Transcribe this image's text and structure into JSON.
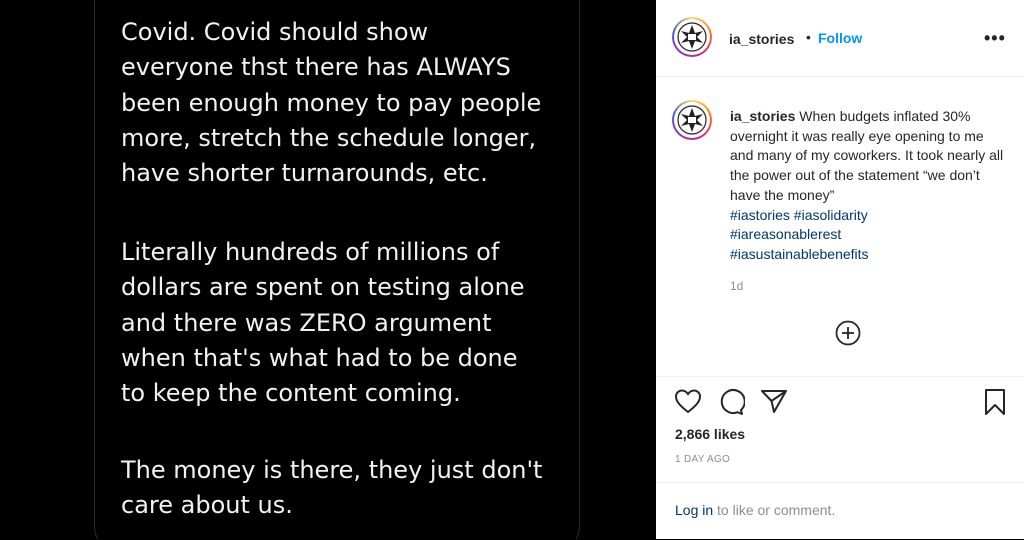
{
  "post_text": {
    "paragraph_1": "Covid. Covid should show\neveryone thst there has ALWAYS\nbeen enough money to pay people\nmore, stretch the schedule longer,\nhave shorter turnarounds, etc.",
    "paragraph_2": "Literally hundreds of millions of\ndollars are spent on testing alone\nand there was ZERO argument\nwhen that's what had to be done\nto keep the content coming.",
    "paragraph_3": "The money is there, they just don't\ncare about us."
  },
  "header": {
    "username": "ia_stories",
    "separator": "•",
    "follow_label": "Follow",
    "more_label": "•••"
  },
  "caption": {
    "username": "ia_stories",
    "text": "When budgets inflated 30% overnight it was really eye opening to me and many of my coworkers. It took nearly all the power out of the statement “we don’t have the money”",
    "hashtags": [
      "#iastories #iasolidarity",
      "#iareasonablerest",
      "#iasustainablebenefits"
    ],
    "age": "1d"
  },
  "likes": "2,866 likes",
  "date": "1 DAY AGO",
  "login": {
    "link": "Log in",
    "text": " to like or comment."
  },
  "icons": {
    "header_avatar": "iatse-logo-avatar",
    "add_comment": "plus-circle-icon",
    "like": "heart-icon",
    "comment": "comment-bubble-icon",
    "share": "paper-plane-icon",
    "save": "bookmark-icon"
  },
  "colors": {
    "link_blue": "#0095f6",
    "hashtag": "#00376b",
    "text": "#262626",
    "muted": "#8e8e8e"
  }
}
